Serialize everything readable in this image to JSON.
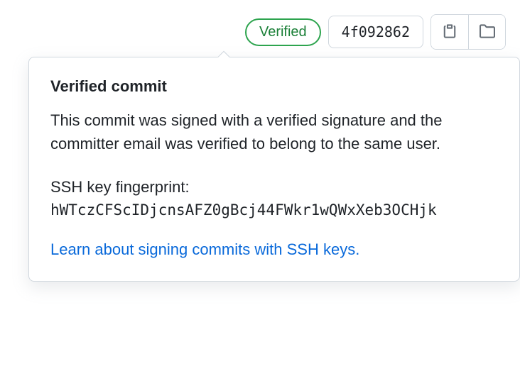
{
  "toolbar": {
    "verified_label": "Verified",
    "commit_hash": "4f092862"
  },
  "popup": {
    "title": "Verified commit",
    "description": "This commit was signed with a verified signature and the committer email was verified to belong to the same user.",
    "fingerprint_label": "SSH key fingerprint:",
    "fingerprint_value": "hWTczCFScIDjcnsAFZ0gBcj44FWkr1wQWxXeb3OCHjk",
    "learn_link": "Learn about signing commits with SSH keys."
  }
}
